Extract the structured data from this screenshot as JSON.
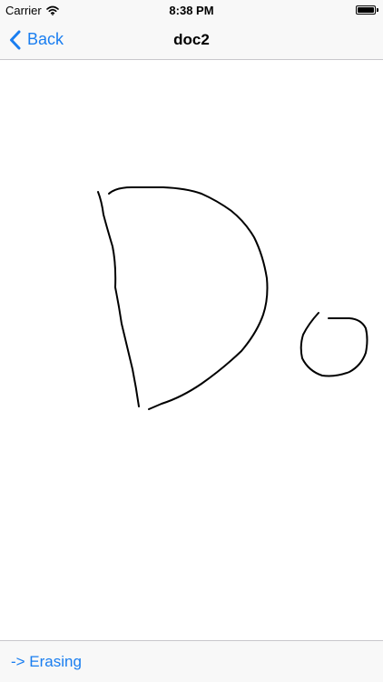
{
  "status_bar": {
    "carrier": "Carrier",
    "time": "8:38 PM",
    "battery_level": 1.0
  },
  "nav_bar": {
    "back_label": "Back",
    "title": "doc2"
  },
  "toolbar": {
    "mode_label": "-> Erasing"
  },
  "colors": {
    "accent": "#1a7ef0",
    "ink": "#000000",
    "bar_background": "#f8f8f8"
  },
  "icons": {
    "back": "chevron-left-icon",
    "wifi": "wifi-icon",
    "battery": "battery-icon"
  }
}
